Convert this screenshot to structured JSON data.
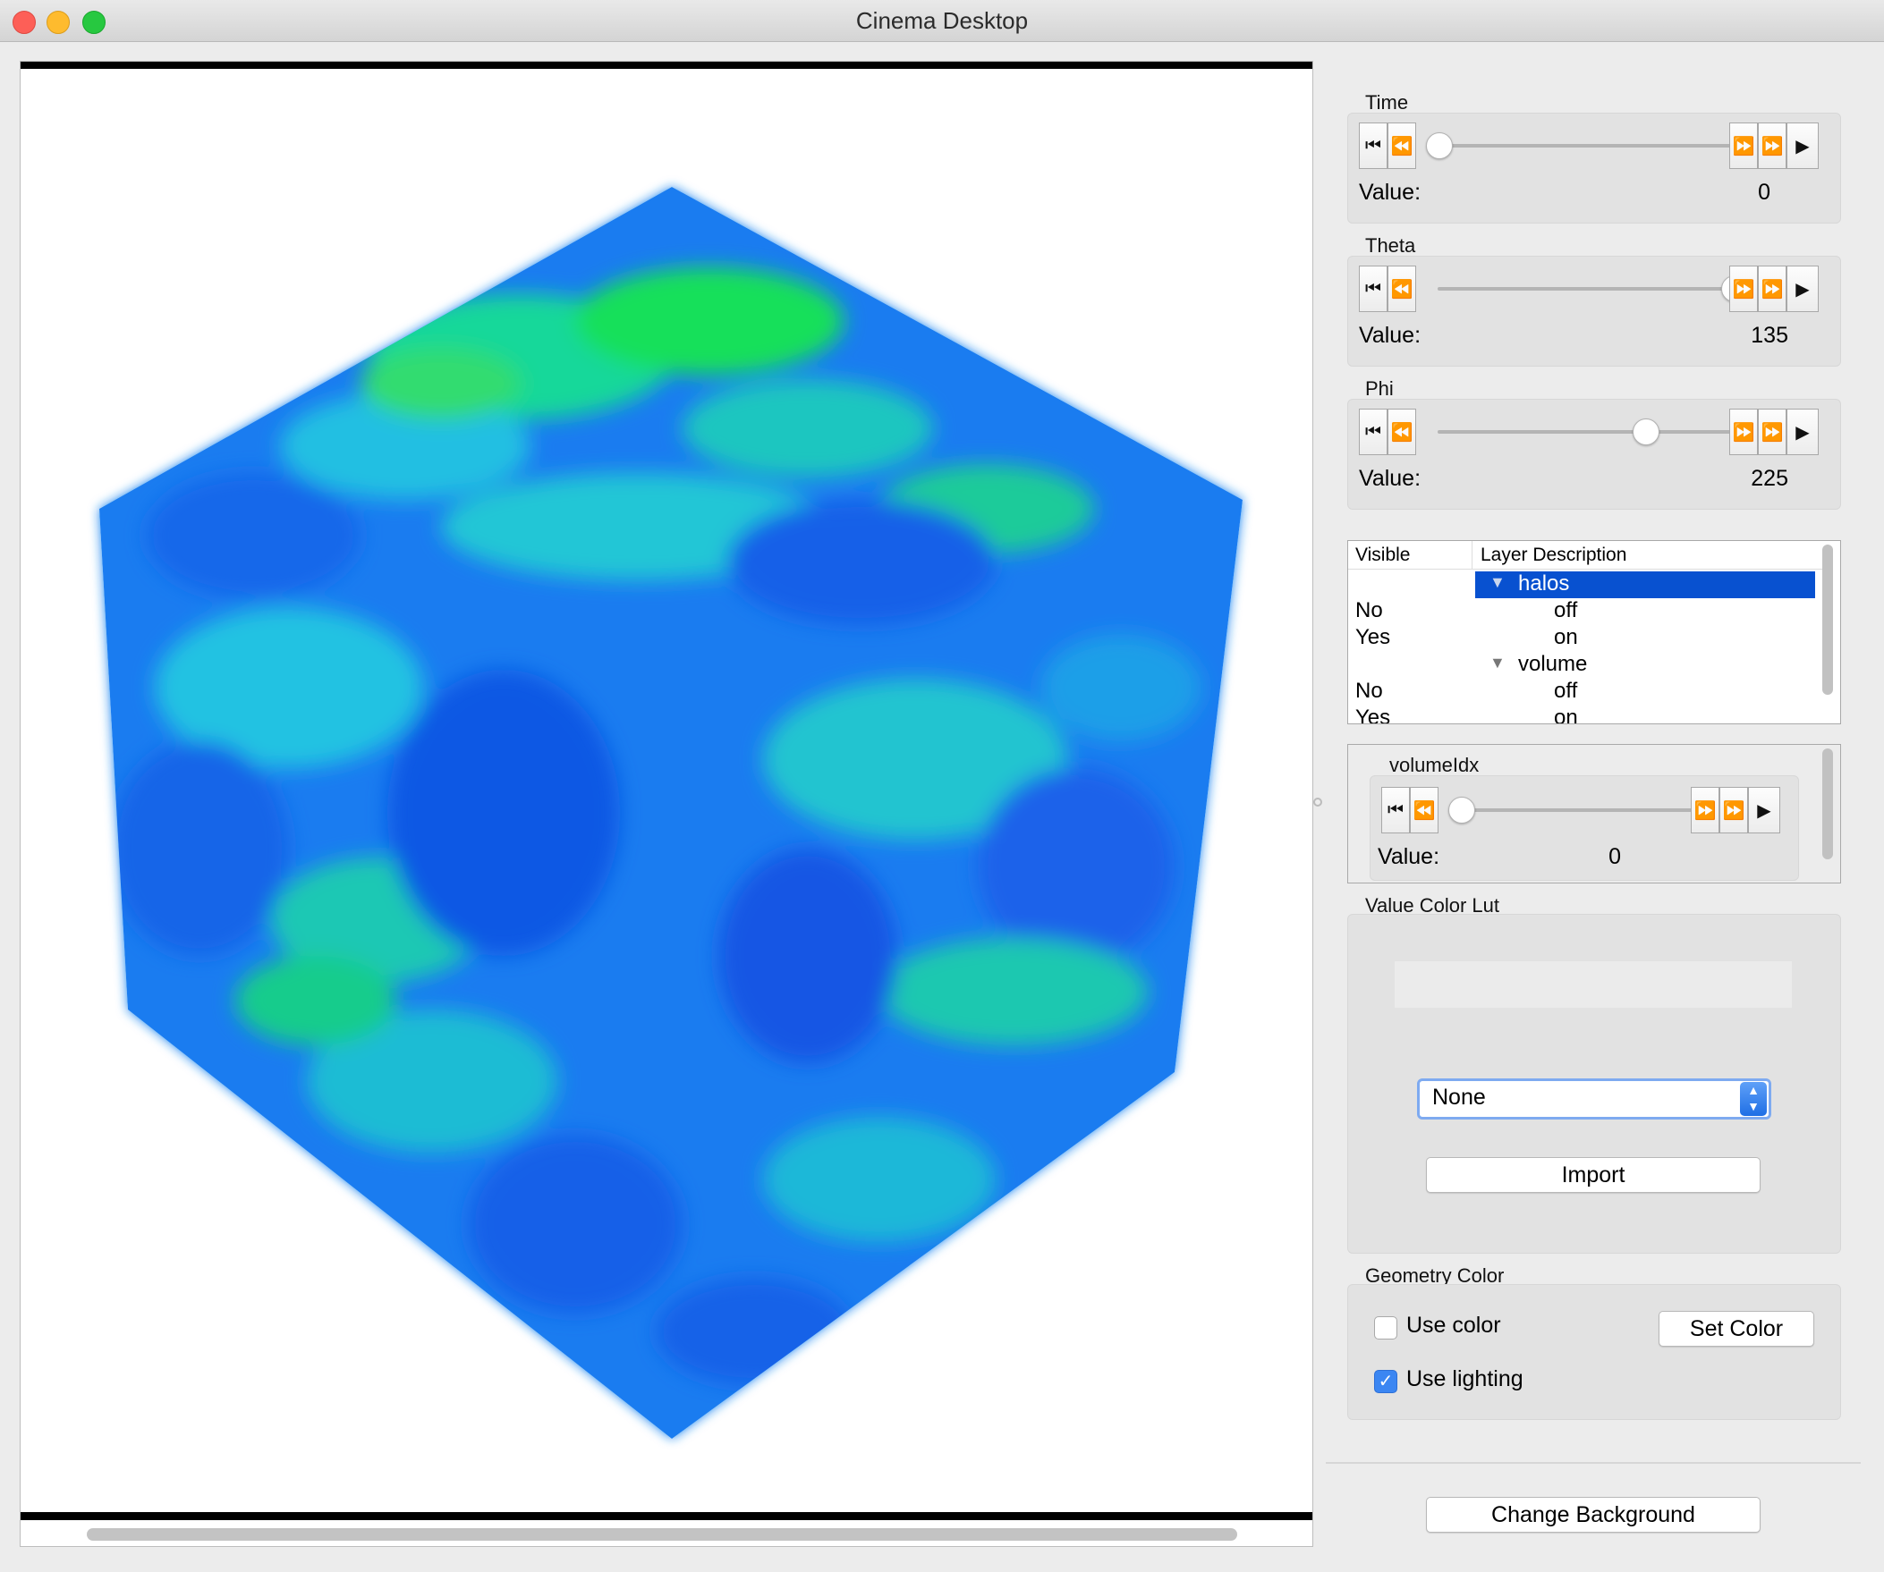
{
  "window": {
    "title": "Cinema Desktop"
  },
  "sliders": [
    {
      "label": "Time",
      "value_label": "Value:",
      "value": "0",
      "position": 0.0
    },
    {
      "label": "Theta",
      "value_label": "Value:",
      "value": "135",
      "position": 1.0
    },
    {
      "label": "Phi",
      "value_label": "Value:",
      "value": "225",
      "position": 0.7
    }
  ],
  "layers": {
    "headers": {
      "visible": "Visible",
      "description": "Layer Description"
    },
    "rows": [
      {
        "visible": "",
        "description": "halos",
        "group": true,
        "selected": true
      },
      {
        "visible": "No",
        "description": "off",
        "group": false
      },
      {
        "visible": "Yes",
        "description": "on",
        "group": false
      },
      {
        "visible": "",
        "description": "volume",
        "group": true
      },
      {
        "visible": "No",
        "description": "off",
        "group": false
      },
      {
        "visible": "Yes",
        "description": "on",
        "group": false
      }
    ]
  },
  "volume_idx": {
    "label": "volumeIdx",
    "value_label": "Value:",
    "value": "0",
    "position": 0.0
  },
  "color_lut": {
    "label": "Value Color Lut",
    "selected": "None",
    "import_label": "Import"
  },
  "geometry": {
    "label": "Geometry Color",
    "use_color": {
      "label": "Use color",
      "checked": false
    },
    "use_lighting": {
      "label": "Use lighting",
      "checked": true
    },
    "set_color_label": "Set Color"
  },
  "change_background_label": "Change Background",
  "colors": {
    "selection": "#0851d0",
    "accent": "#1f6fe5"
  }
}
